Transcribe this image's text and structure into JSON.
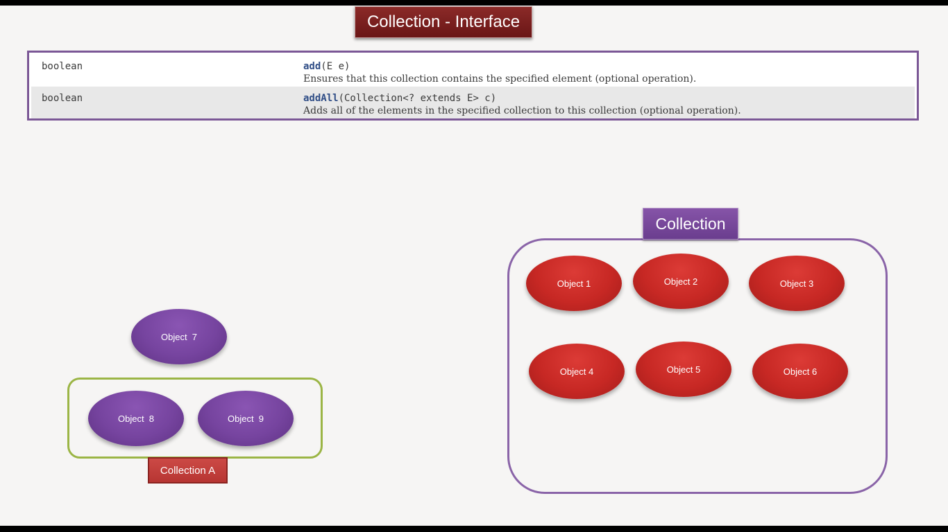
{
  "title": "Collection - Interface",
  "api_rows": [
    {
      "type": "boolean",
      "method": "add",
      "params": "(E e)",
      "description": "Ensures that this collection contains the specified element (optional operation)."
    },
    {
      "type": "boolean",
      "method": "addAll",
      "params": "(Collection<? extends E> c)",
      "description": "Adds all of the elements in the specified collection to this collection (optional operation)."
    }
  ],
  "collection": {
    "label": "Collection",
    "objects": [
      "Object 1",
      "Object 2",
      "Object 3",
      "Object 4",
      "Object 5",
      "Object 6"
    ]
  },
  "collection_a": {
    "label": "Collection A",
    "objects": [
      "Object  8",
      "Object  9"
    ]
  },
  "loose_object": "Object  7",
  "colors": {
    "title_bg": "#7a1f1d",
    "table_border": "#7b5796",
    "collection_border": "#8a64a8",
    "collection_a_border": "#9bb545",
    "red_object": "#c72824",
    "purple_object": "#76449f"
  }
}
